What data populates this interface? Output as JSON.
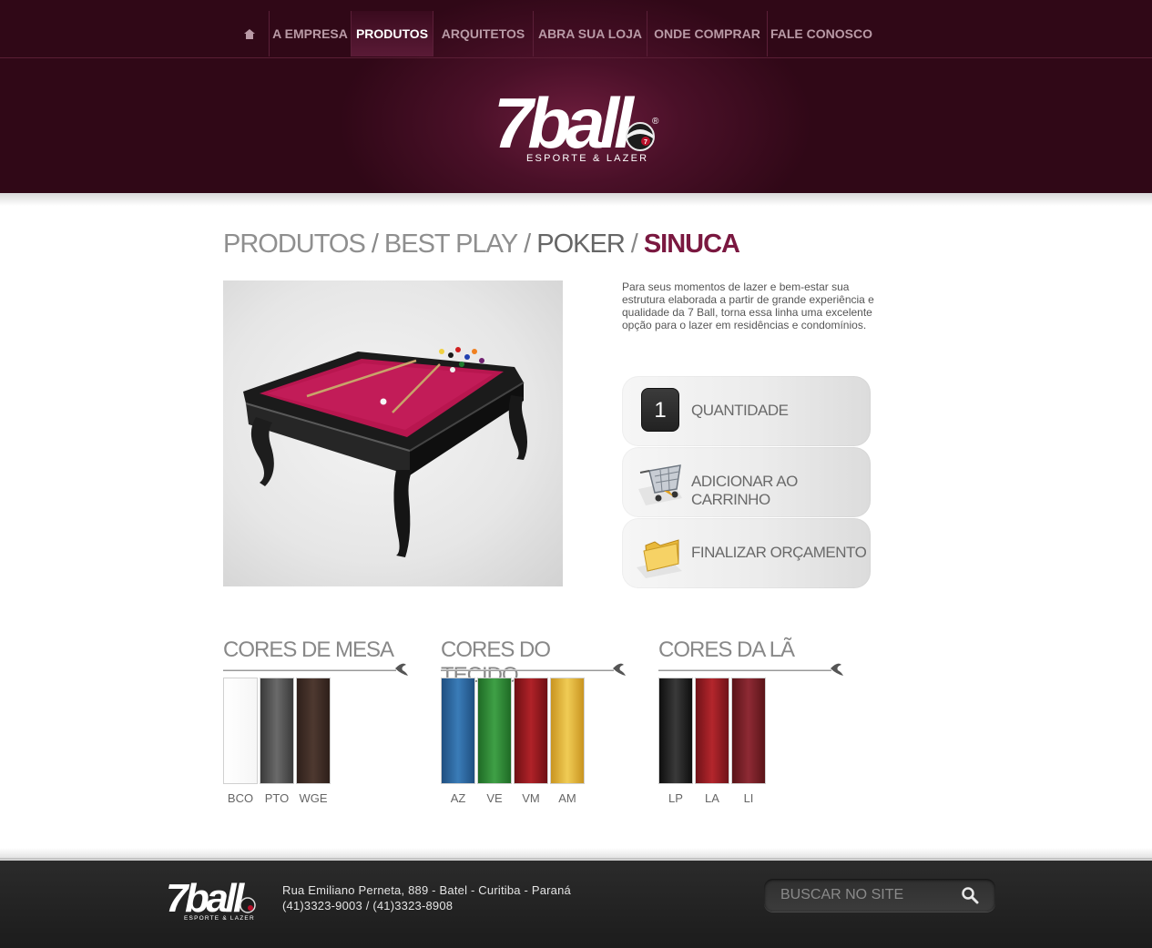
{
  "nav": {
    "home_icon": "home-icon",
    "items": [
      {
        "label": "A EMPRESA"
      },
      {
        "label": "PRODUTOS"
      },
      {
        "label": "ARQUITETOS"
      },
      {
        "label": "ABRA SUA LOJA"
      },
      {
        "label": "ONDE COMPRAR"
      },
      {
        "label": "FALE CONOSCO"
      }
    ],
    "active": "PRODUTOS"
  },
  "logo": {
    "brand": "7ball",
    "tagline": "ESPORTE & LAZER",
    "registered": "®",
    "ball_number": "7"
  },
  "breadcrumb": {
    "items": [
      "PRODUTOS",
      "BEST PLAY",
      "POKER"
    ],
    "separator": "/",
    "current": "SINUCA"
  },
  "product": {
    "description": "Para seus momentos de lazer e bem-estar sua estrutura elaborada a partir de grande experiência e qualidade da 7 Ball, torna essa linha uma excelente opção para o lazer em residências e condomínios."
  },
  "actions": {
    "quantity_value": "1",
    "quantity_label": "QUANTIDADE",
    "add_to_cart_label": "ADICIONAR AO CARRINHO",
    "finish_quote_label": "FINALIZAR ORÇAMENTO"
  },
  "colors": {
    "mesa": {
      "title": "CORES DE MESA",
      "swatches": [
        {
          "code": "BCO",
          "color": "#ffffff"
        },
        {
          "code": "PTO",
          "color": "#555555"
        },
        {
          "code": "WGE",
          "color": "#45302a"
        }
      ]
    },
    "tecido": {
      "title": "CORES DO TECIDO",
      "swatches": [
        {
          "code": "AZ",
          "color": "#2d6aa3"
        },
        {
          "code": "VE",
          "color": "#2f8b35"
        },
        {
          "code": "VM",
          "color": "#9a1a1f"
        },
        {
          "code": "AM",
          "color": "#e0b030"
        }
      ]
    },
    "la": {
      "title": "CORES DA LÃ",
      "swatches": [
        {
          "code": "LP",
          "color": "#1e1e1e"
        },
        {
          "code": "LA",
          "color": "#9a1d22"
        },
        {
          "code": "LI",
          "color": "#7a1e28"
        }
      ]
    }
  },
  "footer": {
    "address": "Rua Emiliano Perneta, 889 - Batel - Curitiba - Paraná",
    "phones": "(41)3323-9003 / (41)3323-8908",
    "search_placeholder": "BUSCAR NO SITE",
    "search_value": ""
  },
  "theme": {
    "accent": "#7a1840",
    "header_dark": "#300817",
    "footer_dark": "#1c1c1c"
  }
}
